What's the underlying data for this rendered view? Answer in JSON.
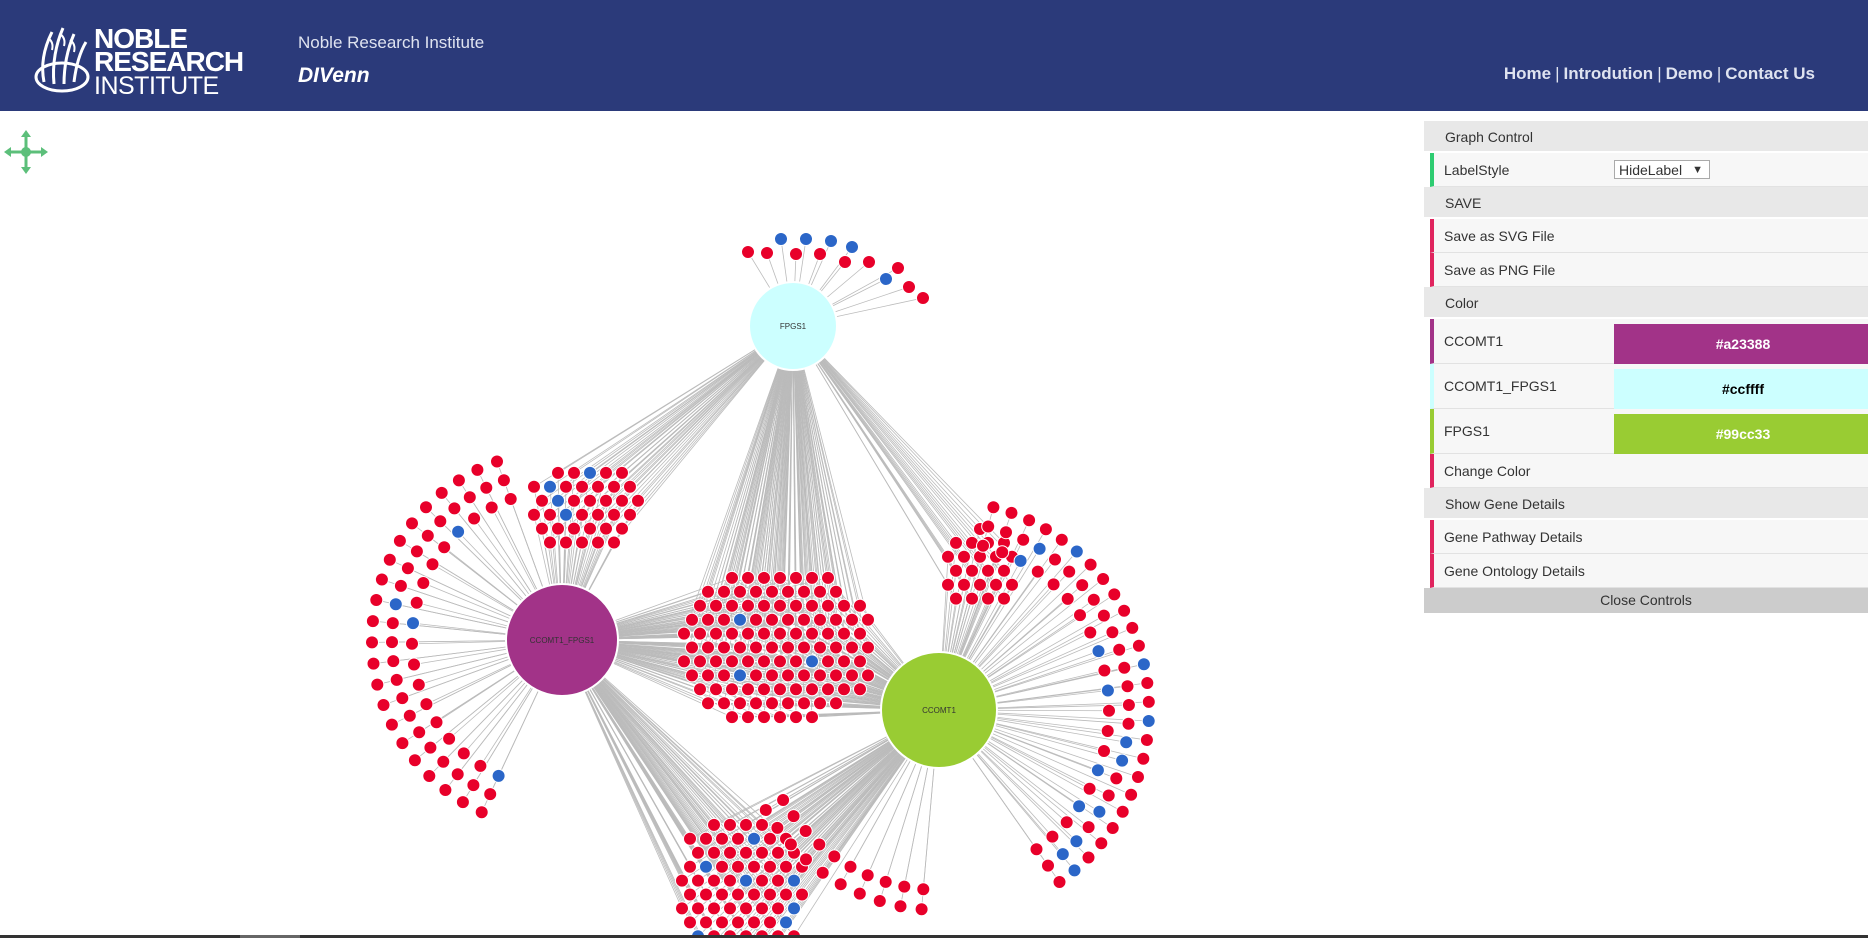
{
  "header": {
    "logo": {
      "line1": "NOBLE",
      "line2": "RESEARCH",
      "line3": "INSTITUTE"
    },
    "org_name": "Noble Research Institute",
    "app_title": "DIVenn",
    "nav": {
      "home": "Home",
      "introduction": "Introdution",
      "demo": "Demo",
      "contact": "Contact Us"
    }
  },
  "panel": {
    "graph_control": "Graph Control",
    "label_style_label": "LabelStyle",
    "label_style_value": "HideLabel",
    "save_header": "SAVE",
    "save_svg": "Save as SVG File",
    "save_png": "Save as PNG File",
    "color_header": "Color",
    "colors": [
      {
        "name": "CCOMT1",
        "value": "#a23388",
        "accent": "#a23388",
        "text": "#ffffff"
      },
      {
        "name": "CCOMT1_FPGS1",
        "value": "#ccffff",
        "accent": "#ccffff",
        "text": "#000000"
      },
      {
        "name": "FPGS1",
        "value": "#99cc33",
        "accent": "#99cc33",
        "text": "#ffffff"
      }
    ],
    "change_color": "Change Color",
    "gene_details_header": "Show Gene Details",
    "pathway_details": "Gene Pathway Details",
    "ontology_details": "Gene Ontology Details",
    "close_controls": "Close Controls"
  },
  "graph": {
    "hubs": [
      {
        "id": "fpgs1",
        "label": "FPGS1",
        "color": "#ccffff"
      },
      {
        "id": "ccomt1_fpgs1",
        "label": "CCOMT1_FPGS1",
        "color": "#a23388"
      },
      {
        "id": "ccomt1",
        "label": "CCOMT1",
        "color": "#99cc33"
      }
    ],
    "node_colors": {
      "up": "#e8002a",
      "down": "#2b66c8"
    },
    "edge_color": "#bbbbbb"
  }
}
